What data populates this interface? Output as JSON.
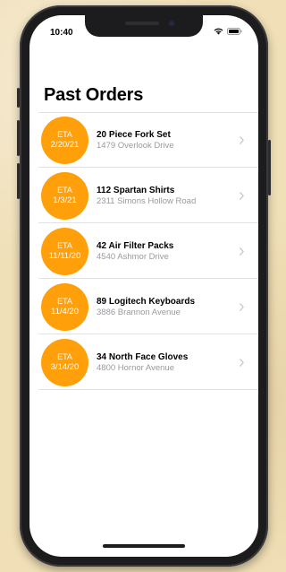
{
  "status_bar": {
    "time": "10:40",
    "icons": [
      "wifi-icon",
      "battery-icon"
    ]
  },
  "page": {
    "title": "Past Orders"
  },
  "orders": [
    {
      "eta_label": "ETA",
      "eta_date": "2/20/21",
      "title": "20 Piece Fork Set",
      "address": "1479  Overlook Drive"
    },
    {
      "eta_label": "ETA",
      "eta_date": "1/3/21",
      "title": "112 Spartan Shirts",
      "address": "2311  Simons Hollow Road"
    },
    {
      "eta_label": "ETA",
      "eta_date": "11/11/20",
      "title": "42 Air Filter Packs",
      "address": "4540  Ashmor Drive"
    },
    {
      "eta_label": "ETA",
      "eta_date": "11/4/20",
      "title": "89 Logitech Keyboards",
      "address": "3886  Brannon Avenue"
    },
    {
      "eta_label": "ETA",
      "eta_date": "3/14/20",
      "title": "34 North Face Gloves",
      "address": "4800  Hornor Avenue"
    }
  ],
  "colors": {
    "accent": "#ff9f0a",
    "secondary_text": "#9a9aa0",
    "background": "#f0dfb7"
  }
}
